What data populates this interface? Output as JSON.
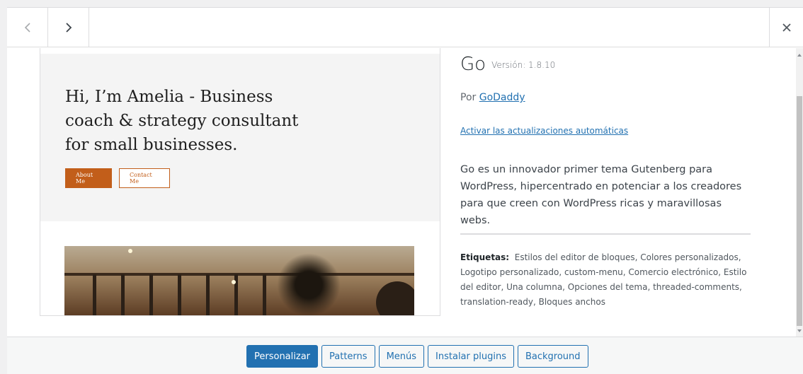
{
  "nav": {
    "prev_icon": "chevron-left-icon",
    "next_icon": "chevron-right-icon",
    "close_icon": "close-icon"
  },
  "preview": {
    "hero_title": "Hi, I’m Amelia - Business coach & strategy consultant for small businesses.",
    "about_button": "About Me",
    "contact_button": "Contact Me"
  },
  "theme": {
    "name": "Go",
    "version_label": "Versión: 1.8.10",
    "author_prefix": "Por ",
    "author": "GoDaddy",
    "auto_updates_link": "Activar las actualizaciones automáticas",
    "description": "Go es un innovador primer tema Gutenberg para WordPress, hipercentrado en potenciar a los creadores para que creen con WordPress ricas y maravillosas webs.",
    "tags_label": "Etiquetas:",
    "tags": "Estilos del editor de bloques, Colores personalizados, Logotipo personalizado, custom-menu, Comercio electrónico, Estilo del editor, Una columna, Opciones del tema, threaded-comments, translation-ready, Bloques anchos"
  },
  "actions": {
    "customize": "Personalizar",
    "patterns": "Patterns",
    "menus": "Menús",
    "install_plugins": "Instalar plugins",
    "background": "Background"
  },
  "colors": {
    "accent": "#2271b1",
    "preview_accent": "#c25e1a"
  }
}
